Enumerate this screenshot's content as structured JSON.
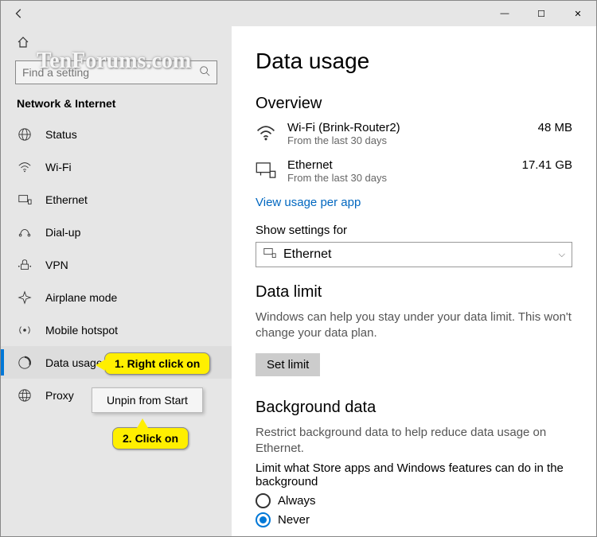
{
  "watermark": "TenForums.com",
  "titlebar": {
    "minimize": "—",
    "maximize": "☐",
    "close": "✕"
  },
  "sidebar": {
    "search_placeholder": "Find a setting",
    "category": "Network & Internet",
    "items": [
      {
        "label": "Status"
      },
      {
        "label": "Wi-Fi"
      },
      {
        "label": "Ethernet"
      },
      {
        "label": "Dial-up"
      },
      {
        "label": "VPN"
      },
      {
        "label": "Airplane mode"
      },
      {
        "label": "Mobile hotspot"
      },
      {
        "label": "Data usage"
      },
      {
        "label": "Proxy"
      }
    ]
  },
  "contextMenu": {
    "item": "Unpin from Start"
  },
  "callouts": {
    "one": "1. Right click on",
    "two": "2. Click on"
  },
  "main": {
    "title": "Data usage",
    "overview": {
      "heading": "Overview",
      "wifi": {
        "name": "Wi-Fi (Brink-Router2)",
        "sub": "From the last 30 days",
        "value": "48 MB"
      },
      "eth": {
        "name": "Ethernet",
        "sub": "From the last 30 days",
        "value": "17.41 GB"
      },
      "link": "View usage per app"
    },
    "showFor": {
      "label": "Show settings for",
      "value": "Ethernet"
    },
    "dataLimit": {
      "heading": "Data limit",
      "desc": "Windows can help you stay under your data limit. This won't change your data plan.",
      "button": "Set limit"
    },
    "bg": {
      "heading": "Background data",
      "desc": "Restrict background data to help reduce data usage on Ethernet.",
      "desc2": "Limit what Store apps and Windows features can do in the background",
      "opt1": "Always",
      "opt2": "Never"
    }
  }
}
